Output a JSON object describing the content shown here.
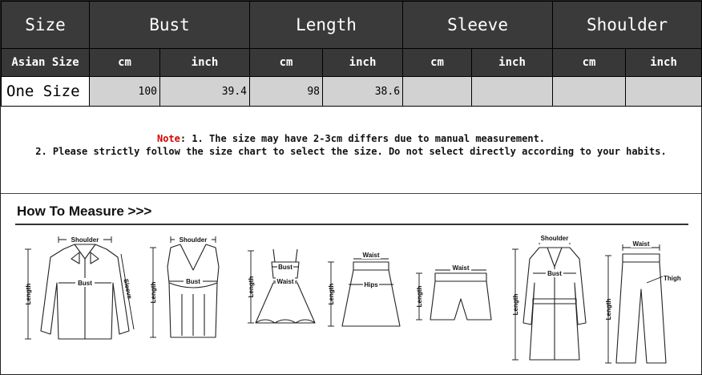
{
  "table": {
    "headers": {
      "size": "Size",
      "bust": "Bust",
      "length": "Length",
      "sleeve": "Sleeve",
      "shoulder": "Shoulder"
    },
    "subheaders": {
      "asian_size": "Asian Size",
      "cm": "cm",
      "inch": "inch"
    },
    "rows": [
      {
        "size": "One Size",
        "bust_cm": "100",
        "bust_inch": "39.4",
        "length_cm": "98",
        "length_inch": "38.6",
        "sleeve_cm": "",
        "sleeve_inch": "",
        "shoulder_cm": "",
        "shoulder_inch": ""
      }
    ]
  },
  "notes": {
    "label": "Note",
    "line1": ": 1. The size may have 2-3cm differs due to manual measurement.",
    "line2": "2. Please strictly follow the size chart to select the size. Do not select directly according to your habits."
  },
  "measure": {
    "title": "How To Measure >>>",
    "labels": {
      "shoulder": "Shoulder",
      "bust": "Bust",
      "length": "Length",
      "sleeve": "Sleeve",
      "waist": "Waist",
      "hips": "Hips",
      "thigh": "Thigh"
    }
  }
}
